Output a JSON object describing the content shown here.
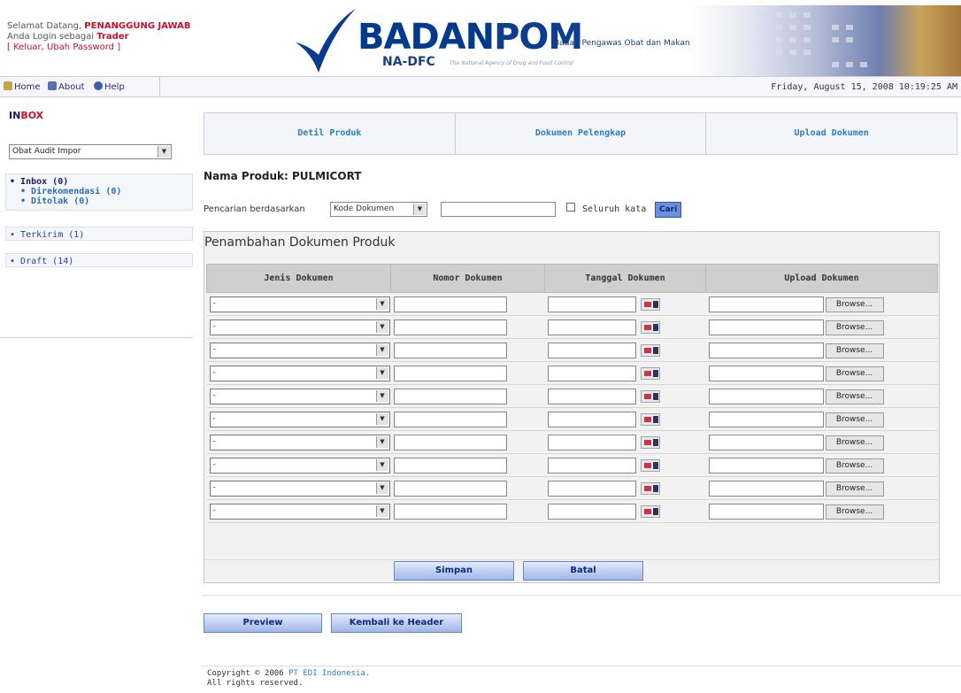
{
  "header": {
    "welcome_prefix": "Selamat Datang, ",
    "welcome_name": "PENANGGUNG JAWAB",
    "login_prefix": "Anda Login sebagai ",
    "login_role": "Trader",
    "logout_link": "[ Keluar, Ubah Password ]",
    "logo_badan": "BADAN",
    "logo_pom": "POM",
    "logo_subtitle": "Badan Pengawas Obat dan Makanan",
    "logo_na": "NA-DFC",
    "logo_na_desc": "The National Agency of Drug and Food Control"
  },
  "nav": {
    "home": "Home",
    "about": "About",
    "help": "Help",
    "date": "Friday, August 15, 2008 10:19:25 AM"
  },
  "sidebar": {
    "inbox_title_a": "IN",
    "inbox_title_b": "BOX",
    "category_select": "Obat Audit Impor",
    "inbox": "Inbox (0)",
    "direkomendasi": "Direkomendasi (0)",
    "ditolak": "Ditolak (0)",
    "terkirim": "Terkirim (1)",
    "draft": "Draft (14)"
  },
  "tabs": [
    "Detil Produk",
    "Dokumen Pelengkap",
    "Upload Dokumen"
  ],
  "product": {
    "label": "Nama Produk: PULMICORT"
  },
  "search": {
    "label": "Pencarian berdasarkan",
    "select_value": "Kode Dokumen",
    "input_value": "",
    "whole_word_label": "Seluruh kata",
    "button": "Cari"
  },
  "panel": {
    "title": "Penambahan Dokumen Produk",
    "columns": [
      "Jenis Dokumen",
      "Nomor Dokumen",
      "Tanggal Dokumen",
      "Upload Dokumen"
    ],
    "row_select_value": "-",
    "browse_label": "Browse...",
    "rows": 10,
    "save_button": "Simpan",
    "cancel_button": "Batal"
  },
  "actions": {
    "preview": "Preview",
    "back_header": "Kembali ke Header"
  },
  "footer": {
    "copyright_prefix": "Copyright © 2006 ",
    "company": "PT EDI Indonesia.",
    "rights": "All rights reserved."
  },
  "colors": {
    "accent_red": "#c8102e",
    "brand_blue": "#003a8c",
    "tab_text": "#2a7fc0"
  }
}
